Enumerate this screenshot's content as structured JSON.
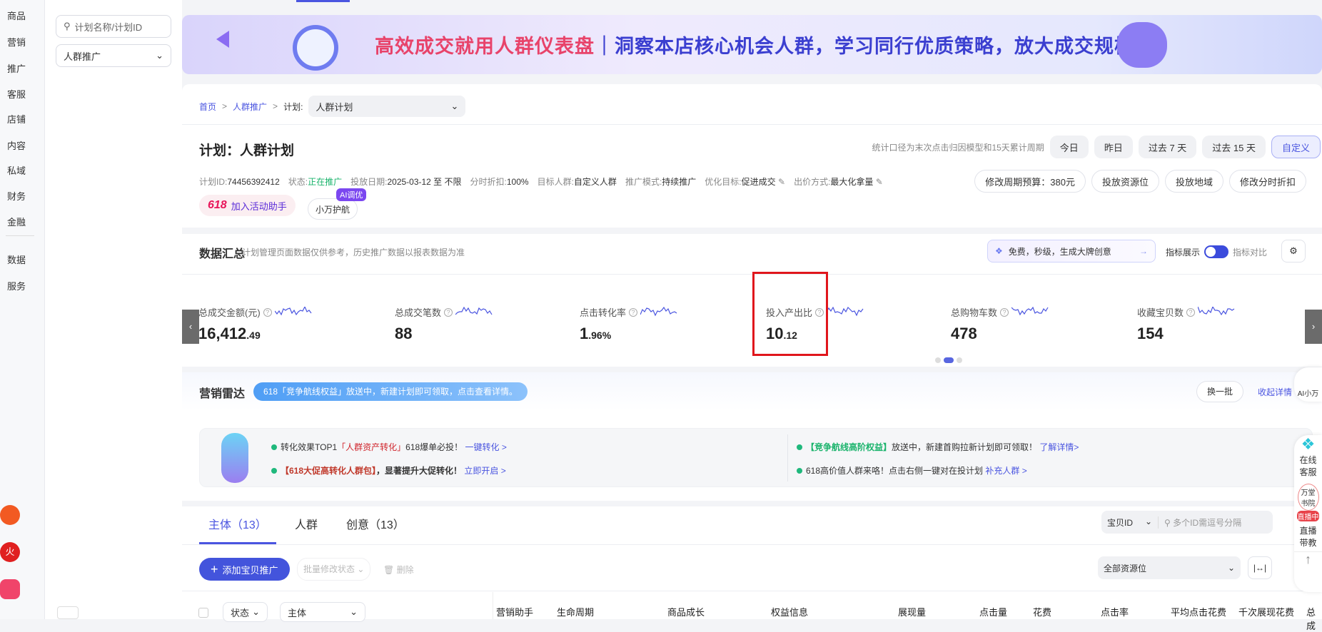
{
  "nav": [
    "商品",
    "营销",
    "推广",
    "客服",
    "店铺",
    "内容",
    "私域",
    "财务",
    "金融",
    "数据",
    "服务"
  ],
  "side": {
    "search_placeholder": "计划名称/计划ID",
    "select": "人群推广"
  },
  "banner": {
    "highlight": "高效成交就用人群仪表盘",
    "rest": "｜洞察本店核心机会人群，学习同行优质策略，放大成交规模！"
  },
  "breadcrumb": {
    "home": "首页",
    "level2": "人群推广",
    "plan_label": "计划:",
    "plan_select": "人群计划"
  },
  "plan": {
    "title": "计划：人群计划",
    "stat_note": "统计口径为末次点击归因模型和15天累计周期",
    "date_buttons": [
      "今日",
      "昨日",
      "过去 7 天",
      "过去 15 天",
      "自定义"
    ],
    "info": [
      {
        "k": "计划ID:",
        "v": "74456392412"
      },
      {
        "k": "状态:",
        "v": "正在推广"
      },
      {
        "k": "投放日期:",
        "v": "2025-03-12 至 不限"
      },
      {
        "k": "分时折扣:",
        "v": "100%"
      },
      {
        "k": "目标人群:",
        "v": "自定义人群"
      },
      {
        "k": "推广模式:",
        "v": "持续推广"
      },
      {
        "k": "优化目标:",
        "v": "促进成交"
      },
      {
        "k": "出价方式:",
        "v": "最大化拿量"
      }
    ],
    "actions": [
      "修改周期预算：380元",
      "投放资源位",
      "投放地域",
      "修改分时折扣"
    ],
    "promo_618": "618",
    "promo_label": "加入活动助手",
    "ai_badge": "AI调优",
    "assistant": "小万护航"
  },
  "summary": {
    "title": "数据汇总",
    "note": "计划管理页面数据仅供参考，历史推广数据以报表数据为准",
    "ai_promo": "免费，秒级，生成大牌创意",
    "toggle_on": "指标展示",
    "toggle_off": "指标对比",
    "metrics": [
      {
        "label": "总成交金额(元)",
        "int": "16,412",
        "dec": ".49"
      },
      {
        "label": "总成交笔数",
        "int": "88",
        "dec": ""
      },
      {
        "label": "点击转化率",
        "int": "1",
        "dec": ".96%"
      },
      {
        "label": "投入产出比",
        "int": "10",
        "dec": ".12"
      },
      {
        "label": "总购物车数",
        "int": "478",
        "dec": ""
      },
      {
        "label": "收藏宝贝数",
        "int": "154",
        "dec": ""
      }
    ],
    "carousel_page": 2,
    "carousel_total": 3
  },
  "radar": {
    "title": "营销雷达",
    "notice": "618「竞争航线权益」放送中，新建计划即可领取，点击查看详情。",
    "refresh": "换一批",
    "collapse": "收起详情",
    "items": [
      {
        "pre": "转化效果TOP1",
        "red": "「人群资产转化」",
        "mid": "618爆单必投！",
        "link": "一键转化 >"
      },
      {
        "pre": "",
        "red": "【618大促高转化人群包】",
        "mid": "，显著提升大促转化！",
        "link": "立即开启 >"
      },
      {
        "pre": "",
        "green": "【竞争航线高阶权益】",
        "mid": "放送中，新建首购拉新计划即可领取！",
        "link": "了解详情>"
      },
      {
        "pre": "618高价值人群来咯！点击右侧一键对在投计划",
        "mid": "",
        "link": "补充人群 >"
      }
    ]
  },
  "tabs": [
    {
      "label": "主体（13）"
    },
    {
      "label": "人群"
    },
    {
      "label": "创意（13）"
    }
  ],
  "filter": {
    "id_select": "宝贝ID",
    "id_placeholder": "多个ID需逗号分隔",
    "resource": "全部资源位"
  },
  "toolbar": {
    "add": "添加宝贝推广",
    "batch": "批量修改状态",
    "delete": "删除"
  },
  "table": {
    "status": "状态",
    "subject": "主体",
    "cols": [
      "营销助手",
      "生命周期",
      "商品成长",
      "权益信息",
      "展现量",
      "点击量",
      "花费",
      "点击率",
      "平均点击花费",
      "千次展现花费",
      "总成"
    ]
  },
  "float": {
    "ai": "AI小万",
    "online": "在线客服",
    "academy": "万堂书院",
    "live": "直播中",
    "live_teach": "直播带教"
  }
}
